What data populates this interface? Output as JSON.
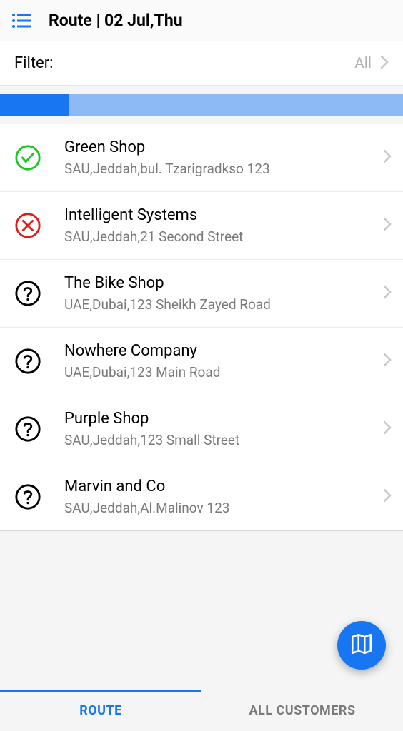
{
  "header": {
    "title": "Route | 02 Jul,Thu"
  },
  "filter": {
    "label": "Filter:",
    "value": "All"
  },
  "progress": {
    "percent": 17
  },
  "items": [
    {
      "status": "check",
      "title": "Green Shop",
      "subtitle": "SAU,Jeddah,bul. Tzarigradkso 123"
    },
    {
      "status": "x",
      "title": "Intelligent Systems",
      "subtitle": "SAU,Jeddah,21 Second Street"
    },
    {
      "status": "question",
      "title": "The Bike Shop",
      "subtitle": "UAE,Dubai,123 Sheikh Zayed Road"
    },
    {
      "status": "question",
      "title": "Nowhere Company",
      "subtitle": "UAE,Dubai,123 Main Road"
    },
    {
      "status": "question",
      "title": "Purple Shop",
      "subtitle": "SAU,Jeddah,123 Small Street"
    },
    {
      "status": "question",
      "title": "Marvin and Co",
      "subtitle": "SAU,Jeddah,Al.Malinov 123"
    }
  ],
  "tabs": {
    "route": "ROUTE",
    "all": "ALL CUSTOMERS"
  }
}
